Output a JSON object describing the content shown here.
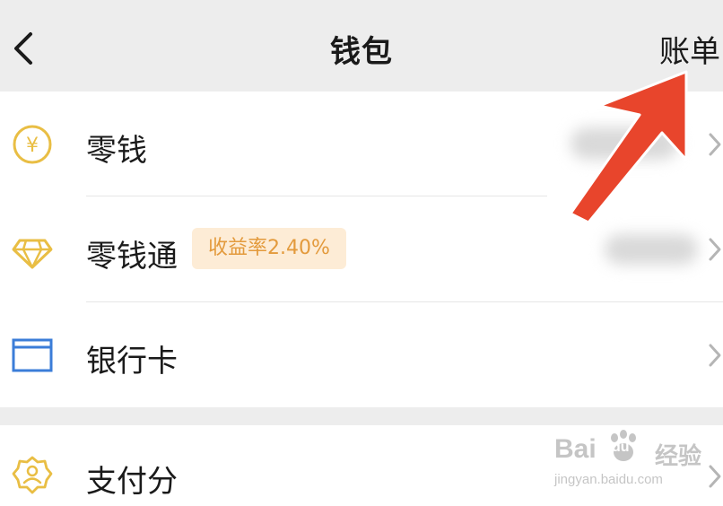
{
  "navbar": {
    "title": "钱包",
    "bill_label": "账单",
    "back_icon": "chevron-left-icon"
  },
  "menu": {
    "items": [
      {
        "label": "零钱",
        "icon": "yuan-coin-icon",
        "icon_color": "#E9BE44"
      },
      {
        "label": "零钱通",
        "icon": "diamond-icon",
        "icon_color": "#E9BE44",
        "badge": "收益率2.40%"
      },
      {
        "label": "银行卡",
        "icon": "bank-card-icon",
        "icon_color": "#3B7DD8"
      },
      {
        "label": "支付分",
        "icon": "pay-score-icon",
        "icon_color": "#E9BE44"
      }
    ]
  },
  "annotation": {
    "arrow_color": "#E8452C"
  },
  "watermark": {
    "logo_text": "Bai",
    "logo_text2": "du",
    "brand_text": "经验",
    "url": "jingyan.baidu.com"
  },
  "colors": {
    "background": "#EDEDED",
    "card": "#FFFFFF",
    "badge_bg": "#FDECD6",
    "badge_text": "#E39A3C"
  }
}
